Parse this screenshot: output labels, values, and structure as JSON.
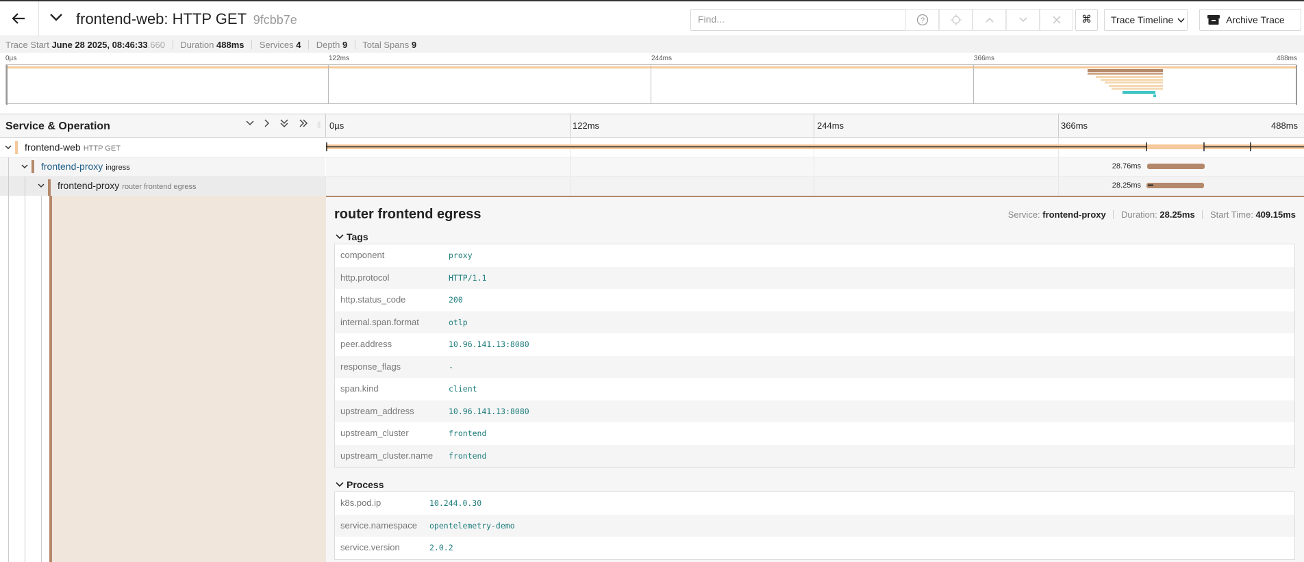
{
  "header": {
    "title": "frontend-web: HTTP GET",
    "trace_id": "9fcbb7e",
    "find_placeholder": "Find...",
    "view_label": "Trace Timeline",
    "archive_label": "Archive Trace"
  },
  "summary": {
    "trace_start_label": "Trace Start",
    "trace_start_value": "June 28 2025, 08:46:33",
    "trace_start_ms": ".660",
    "duration_label": "Duration",
    "duration_value": "488ms",
    "services_label": "Services",
    "services_value": "4",
    "depth_label": "Depth",
    "depth_value": "9",
    "total_spans_label": "Total Spans",
    "total_spans_value": "9"
  },
  "minimap": {
    "ticks": [
      "0µs",
      "122ms",
      "244ms",
      "366ms",
      "488ms"
    ]
  },
  "timeline": {
    "column_title": "Service & Operation",
    "ticks": [
      "0µs",
      "122ms",
      "244ms",
      "366ms",
      "488ms"
    ]
  },
  "spans": [
    {
      "service": "frontend-web",
      "operation": "HTTP GET",
      "color": "#f5c99b",
      "start_ms": 0,
      "duration_ms": 488,
      "label": ""
    },
    {
      "service": "frontend-proxy",
      "operation": "ingress",
      "color": "#b4886a",
      "start_ms": 409.6,
      "duration_ms": 28.76,
      "label": "28.76ms"
    },
    {
      "service": "frontend-proxy",
      "operation": "router frontend egress",
      "color": "#b4886a",
      "start_ms": 409.15,
      "duration_ms": 28.25,
      "label": "28.25ms"
    }
  ],
  "detail": {
    "title": "router frontend egress",
    "service_label": "Service:",
    "service_value": "frontend-proxy",
    "duration_label": "Duration:",
    "duration_value": "28.25ms",
    "start_label": "Start Time:",
    "start_value": "409.15ms",
    "tags_title": "Tags",
    "tags": [
      {
        "key": "component",
        "value": "proxy"
      },
      {
        "key": "http.protocol",
        "value": "HTTP/1.1"
      },
      {
        "key": "http.status_code",
        "value": "200"
      },
      {
        "key": "internal.span.format",
        "value": "otlp"
      },
      {
        "key": "peer.address",
        "value": "10.96.141.13:8080"
      },
      {
        "key": "response_flags",
        "value": "-"
      },
      {
        "key": "span.kind",
        "value": "client"
      },
      {
        "key": "upstream_address",
        "value": "10.96.141.13:8080"
      },
      {
        "key": "upstream_cluster",
        "value": "frontend"
      },
      {
        "key": "upstream_cluster.name",
        "value": "frontend"
      }
    ],
    "process_title": "Process",
    "process": [
      {
        "key": "k8s.pod.ip",
        "value": "10.244.0.30"
      },
      {
        "key": "service.namespace",
        "value": "opentelemetry-demo"
      },
      {
        "key": "service.version",
        "value": "2.0.2"
      }
    ]
  },
  "colors": {
    "frontend_web": "#f5c99b",
    "frontend_proxy": "#b4886a",
    "other_service": "#40c4c4",
    "tag_value": "#1d7b7b"
  }
}
